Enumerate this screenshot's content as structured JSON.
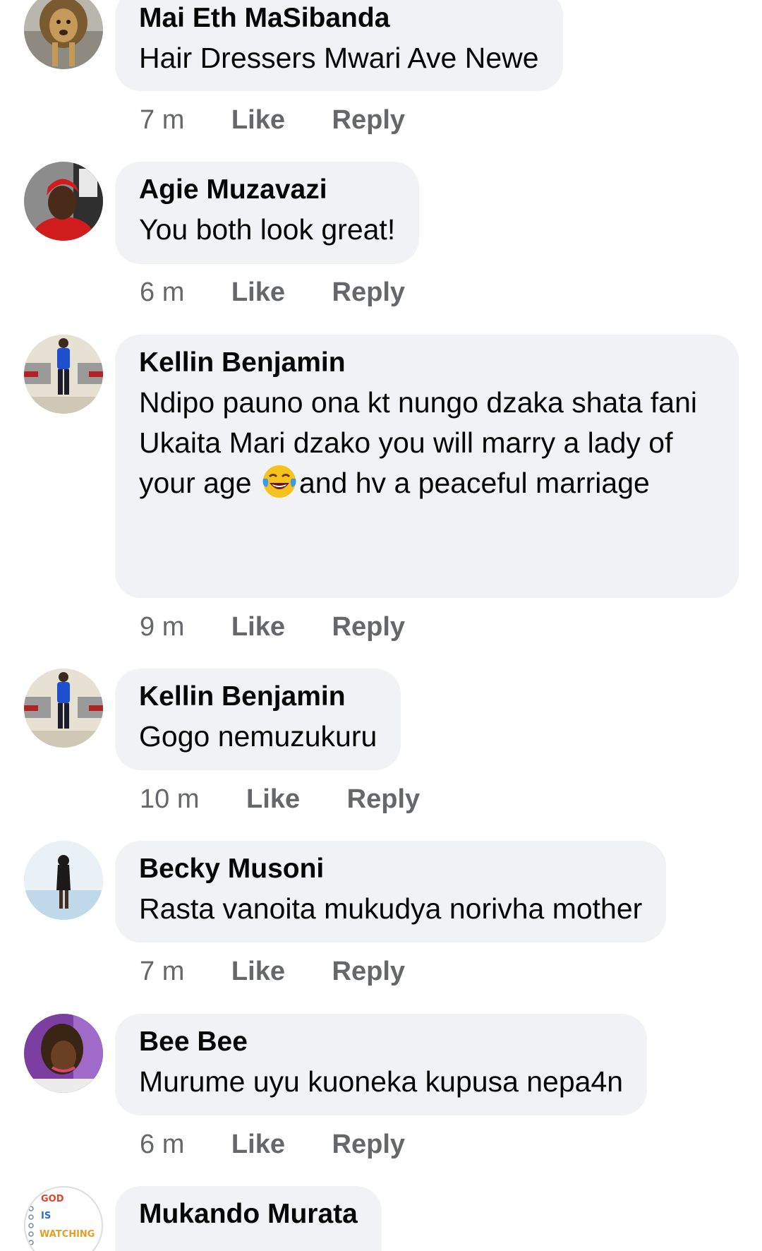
{
  "comments": [
    {
      "author": "Mai Eth MaSibanda",
      "text": "Hair Dressers Mwari Ave Newe",
      "time": "7 m",
      "like": "Like",
      "reply": "Reply"
    },
    {
      "author": "Agie Muzavazi",
      "text": "You both look great!",
      "time": "6 m",
      "like": "Like",
      "reply": "Reply"
    },
    {
      "author": "Kellin Benjamin",
      "text_before_emoji": "Ndipo pauno ona kt nungo dzaka shata fani\nUkaita Mari dzako you will marry a lady of your age ",
      "emoji": "face-with-tears-of-joy",
      "text_after_emoji": "and hv a peaceful marriage",
      "time": "9 m",
      "like": "Like",
      "reply": "Reply"
    },
    {
      "author": "Kellin Benjamin",
      "text": "Gogo nemuzukuru",
      "time": "10 m",
      "like": "Like",
      "reply": "Reply"
    },
    {
      "author": "Becky Musoni",
      "text": "Rasta vanoita mukudya norivha mother",
      "time": "7 m",
      "like": "Like",
      "reply": "Reply"
    },
    {
      "author": "Bee Bee",
      "text": "Murume uyu kuoneka kupusa nepa4n",
      "time": "6 m",
      "like": "Like",
      "reply": "Reply"
    },
    {
      "author": "Mukando Murata",
      "avatar_text": [
        "GOD",
        "IS",
        "WATCHING"
      ]
    }
  ],
  "colors": {
    "bubble": "#f0f2f5",
    "meta": "#65676b",
    "text": "#050505"
  }
}
